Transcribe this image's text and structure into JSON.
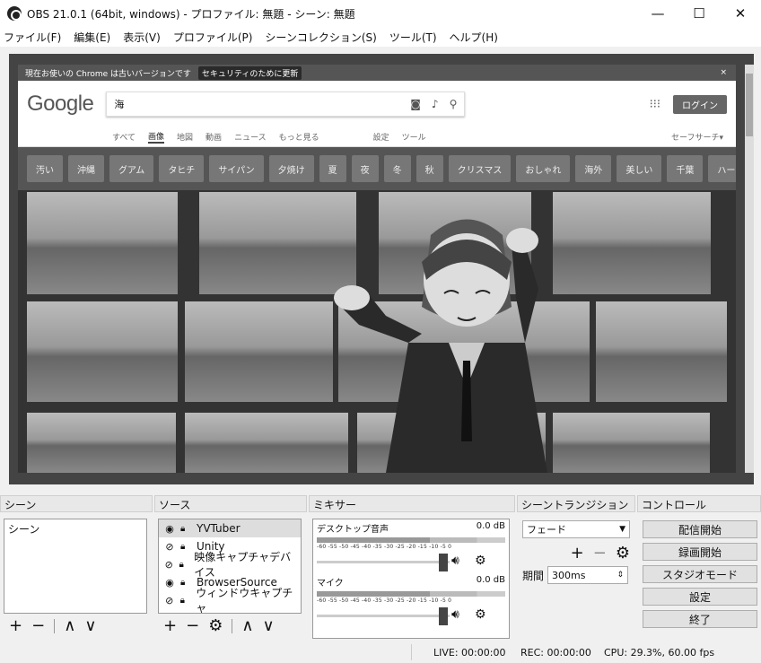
{
  "window": {
    "title": "OBS 21.0.1 (64bit, windows) - プロファイル: 無題 - シーン: 無題",
    "minimize": "—",
    "maximize": "☐",
    "close": "✕"
  },
  "menu": [
    "ファイル(F)",
    "編集(E)",
    "表示(V)",
    "プロファイル(P)",
    "シーンコレクション(S)",
    "ツール(T)",
    "ヘルプ(H)"
  ],
  "browser": {
    "banner": "現在お使いの Chrome は古いバージョンです",
    "update_button": "セキュリティのために更新",
    "banner_close": "×",
    "logo": "Google",
    "query": "海",
    "login": "ログイン",
    "tabs": [
      "すべて",
      "画像",
      "地図",
      "動画",
      "ニュース",
      "もっと見る"
    ],
    "tools": [
      "設定",
      "ツール"
    ],
    "safesearch": "セーフサーチ▾",
    "chips": [
      "汚い",
      "沖縄",
      "グアム",
      "タヒチ",
      "サイパン",
      "夕焼け",
      "夏",
      "夜",
      "冬",
      "秋",
      "クリスマス",
      "おしゃれ",
      "海外",
      "美しい",
      "千葉",
      "ハート"
    ]
  },
  "docks": {
    "scenes": {
      "header": "シーン",
      "items": [
        "シーン"
      ]
    },
    "sources": {
      "header": "ソース",
      "items": [
        {
          "name": "YVTuber",
          "visible": true
        },
        {
          "name": "Unity",
          "visible": false
        },
        {
          "name": "映像キャプチャデバイス",
          "visible": false
        },
        {
          "name": "BrowserSource",
          "visible": true
        },
        {
          "name": "ウィンドウキャプチャ",
          "visible": false
        }
      ]
    },
    "mixer": {
      "header": "ミキサー",
      "ticks": "-60 -55 -50 -45 -40 -35 -30 -25 -20 -15 -10 -5 0",
      "channels": [
        {
          "name": "デスクトップ音声",
          "db": "0.0 dB"
        },
        {
          "name": "マイク",
          "db": "0.0 dB"
        }
      ]
    },
    "transitions": {
      "header": "シーントランジション",
      "selected": "フェード",
      "duration_label": "期間",
      "duration_value": "300ms"
    },
    "controls": {
      "header": "コントロール",
      "buttons": [
        "配信開始",
        "録画開始",
        "スタジオモード",
        "設定",
        "終了"
      ]
    }
  },
  "status": {
    "live": "LIVE: 00:00:00",
    "rec": "REC: 00:00:00",
    "cpu": "CPU: 29.3%, 60.00 fps"
  }
}
